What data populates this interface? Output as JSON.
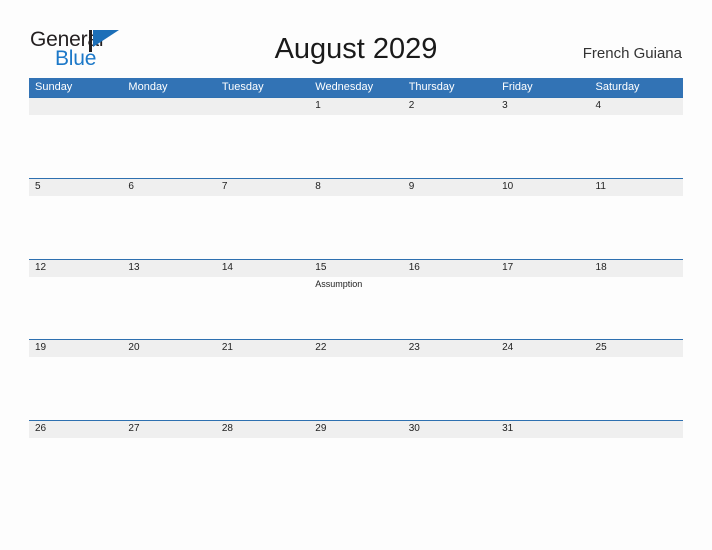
{
  "brand": {
    "name_dark": "General",
    "name_blue": "Blue",
    "flag_icon": "flag-triangle-icon",
    "dark_color": "#231f20",
    "blue_color": "#1c78c8"
  },
  "header": {
    "title": "August 2029",
    "region": "French Guiana"
  },
  "theme": {
    "header_blue": "#3273b5",
    "row_rule_blue": "#2e70b0",
    "day_band_gray": "#efefef",
    "page_background": "#fdfdfd",
    "text_color": "#222222"
  },
  "calendar": {
    "month": "August",
    "year": "2029",
    "weekday_headers": [
      "Sunday",
      "Monday",
      "Tuesday",
      "Wednesday",
      "Thursday",
      "Friday",
      "Saturday"
    ],
    "weeks": [
      [
        {
          "day": "",
          "event": ""
        },
        {
          "day": "",
          "event": ""
        },
        {
          "day": "",
          "event": ""
        },
        {
          "day": "1",
          "event": ""
        },
        {
          "day": "2",
          "event": ""
        },
        {
          "day": "3",
          "event": ""
        },
        {
          "day": "4",
          "event": ""
        }
      ],
      [
        {
          "day": "5",
          "event": ""
        },
        {
          "day": "6",
          "event": ""
        },
        {
          "day": "7",
          "event": ""
        },
        {
          "day": "8",
          "event": ""
        },
        {
          "day": "9",
          "event": ""
        },
        {
          "day": "10",
          "event": ""
        },
        {
          "day": "11",
          "event": ""
        }
      ],
      [
        {
          "day": "12",
          "event": ""
        },
        {
          "day": "13",
          "event": ""
        },
        {
          "day": "14",
          "event": ""
        },
        {
          "day": "15",
          "event": "Assumption"
        },
        {
          "day": "16",
          "event": ""
        },
        {
          "day": "17",
          "event": ""
        },
        {
          "day": "18",
          "event": ""
        }
      ],
      [
        {
          "day": "19",
          "event": ""
        },
        {
          "day": "20",
          "event": ""
        },
        {
          "day": "21",
          "event": ""
        },
        {
          "day": "22",
          "event": ""
        },
        {
          "day": "23",
          "event": ""
        },
        {
          "day": "24",
          "event": ""
        },
        {
          "day": "25",
          "event": ""
        }
      ],
      [
        {
          "day": "26",
          "event": ""
        },
        {
          "day": "27",
          "event": ""
        },
        {
          "day": "28",
          "event": ""
        },
        {
          "day": "29",
          "event": ""
        },
        {
          "day": "30",
          "event": ""
        },
        {
          "day": "31",
          "event": ""
        },
        {
          "day": "",
          "event": ""
        }
      ]
    ]
  }
}
